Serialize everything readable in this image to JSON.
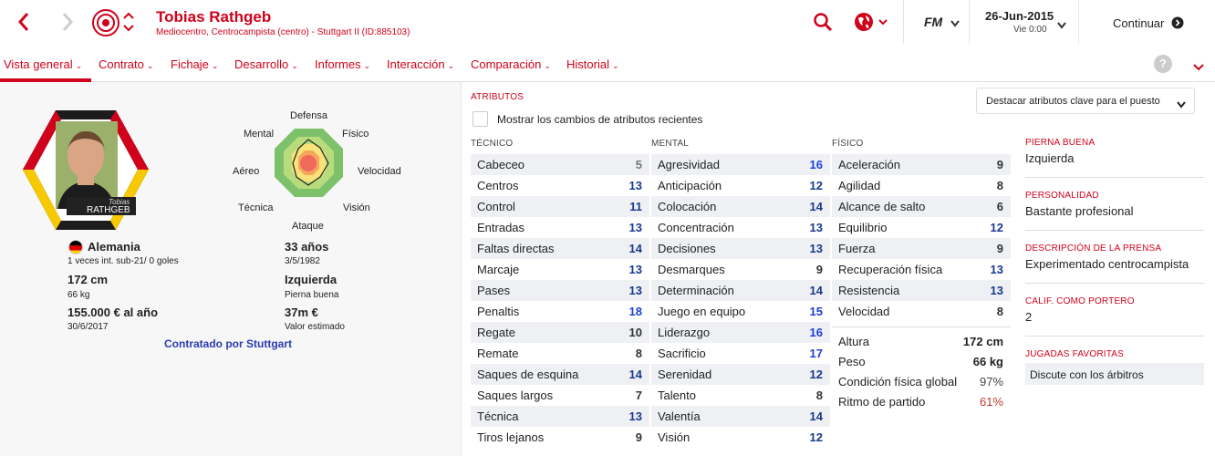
{
  "header": {
    "player_name": "Tobias Rathgeb",
    "player_subtitle": "Mediocentro, Centrocampista (centro) - Stuttgart II (ID:885103)",
    "brand": "FM",
    "date": "26-Jun-2015",
    "time": "Vie 0:00",
    "continue_label": "Continuar"
  },
  "nav": {
    "items": [
      {
        "label": "Vista general"
      },
      {
        "label": "Contrato"
      },
      {
        "label": "Fichaje"
      },
      {
        "label": "Desarrollo"
      },
      {
        "label": "Informes"
      },
      {
        "label": "Interacción"
      },
      {
        "label": "Comparación"
      },
      {
        "label": "Historial"
      }
    ],
    "help": "?"
  },
  "profile": {
    "card_name_small": "Tobias",
    "card_name_large": "RATHGEB",
    "nationality": "Alemania",
    "caps": "1 veces int. sub-21/ 0 goles",
    "age": "33 años",
    "dob": "3/5/1982",
    "height": "172 cm",
    "weight": "66 kg",
    "foot": "Izquierda",
    "foot_label": "Pierna buena",
    "wage": "155.000 € al año",
    "contract_end": "30/6/2017",
    "value": "37m €",
    "value_label": "Valor estimado",
    "contracted_by": "Contratado por Stuttgart"
  },
  "radar": {
    "labels": {
      "defensa": "Defensa",
      "fisico": "Físico",
      "velocidad": "Velocidad",
      "vision": "Visión",
      "ataque": "Ataque",
      "tecnica": "Técnica",
      "aereo": "Aéreo",
      "mental": "Mental"
    }
  },
  "attributes": {
    "title": "ATRIBUTOS",
    "highlight_dropdown": "Destacar atributos clave para el puesto",
    "show_changes": "Mostrar los cambios de atributos recientes",
    "tecnico_title": "TÉCNICO",
    "mental_title": "MENTAL",
    "fisico_title": "FÍSICO",
    "tecnico": [
      {
        "name": "Cabeceo",
        "value": "5"
      },
      {
        "name": "Centros",
        "value": "13"
      },
      {
        "name": "Control",
        "value": "11"
      },
      {
        "name": "Entradas",
        "value": "13"
      },
      {
        "name": "Faltas directas",
        "value": "14"
      },
      {
        "name": "Marcaje",
        "value": "13"
      },
      {
        "name": "Pases",
        "value": "13"
      },
      {
        "name": "Penaltis",
        "value": "18"
      },
      {
        "name": "Regate",
        "value": "10"
      },
      {
        "name": "Remate",
        "value": "8"
      },
      {
        "name": "Saques de esquina",
        "value": "14"
      },
      {
        "name": "Saques largos",
        "value": "7"
      },
      {
        "name": "Técnica",
        "value": "13"
      },
      {
        "name": "Tiros lejanos",
        "value": "9"
      }
    ],
    "mental": [
      {
        "name": "Agresividad",
        "value": "16"
      },
      {
        "name": "Anticipación",
        "value": "12"
      },
      {
        "name": "Colocación",
        "value": "14"
      },
      {
        "name": "Concentración",
        "value": "13"
      },
      {
        "name": "Decisiones",
        "value": "13"
      },
      {
        "name": "Desmarques",
        "value": "9"
      },
      {
        "name": "Determinación",
        "value": "14"
      },
      {
        "name": "Juego en equipo",
        "value": "15"
      },
      {
        "name": "Liderazgo",
        "value": "16"
      },
      {
        "name": "Sacrificio",
        "value": "17"
      },
      {
        "name": "Serenidad",
        "value": "12"
      },
      {
        "name": "Talento",
        "value": "8"
      },
      {
        "name": "Valentía",
        "value": "14"
      },
      {
        "name": "Visión",
        "value": "12"
      }
    ],
    "fisico": [
      {
        "name": "Aceleración",
        "value": "9"
      },
      {
        "name": "Agilidad",
        "value": "8"
      },
      {
        "name": "Alcance de salto",
        "value": "6"
      },
      {
        "name": "Equilibrio",
        "value": "12"
      },
      {
        "name": "Fuerza",
        "value": "9"
      },
      {
        "name": "Recuperación física",
        "value": "13"
      },
      {
        "name": "Resistencia",
        "value": "13"
      },
      {
        "name": "Velocidad",
        "value": "8"
      }
    ],
    "extra": [
      {
        "name": "Altura",
        "value": "172 cm"
      },
      {
        "name": "Peso",
        "value": "66 kg"
      },
      {
        "name": "Condición física global",
        "value": "97%"
      },
      {
        "name": "Ritmo de partido",
        "value": "61%"
      }
    ]
  },
  "side": {
    "foot_title": "PIERNA BUENA",
    "foot_value": "Izquierda",
    "personality_title": "PERSONALIDAD",
    "personality_value": "Bastante profesional",
    "press_title": "DESCRIPCIÓN DE LA PRENSA",
    "press_value": "Experimentado centrocampista",
    "gk_title": "CALIF. COMO PORTERO",
    "gk_value": "2",
    "traits_title": "JUGADAS FAVORITAS",
    "traits_value": "Discute con los árbitros"
  },
  "colors": {
    "accent": "#d0021b",
    "val_low": "#777777",
    "val_mid": "#333333",
    "val_good": "#1a3a8c",
    "val_top": "#1e40d8"
  }
}
